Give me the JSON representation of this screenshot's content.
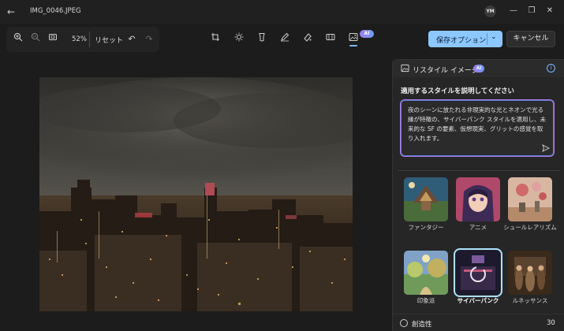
{
  "titlebar": {
    "filename": "IMG_0046.JPEG",
    "avatar_initials": "YM",
    "minimize": "—",
    "restore": "❐",
    "close": "✕"
  },
  "toolbar": {
    "zoom_level": "52%",
    "reset_label": "リセット",
    "ai_badge": "AI",
    "save_label": "保存オプション",
    "cancel_label": "キャンセル"
  },
  "panel": {
    "title": "リスタイル イメージ",
    "ai_badge": "AI",
    "prompt_label": "適用するスタイルを説明してください",
    "prompt_text": "夜のシーンに放たれる非現実的な光とネオンで光る縁が特徴の、サイバーパンク スタイルを適用し、未来的な SF の要素、仮想現実、グリットの感覚を取り入れます。",
    "styles": [
      {
        "label": "ファンタジー"
      },
      {
        "label": "アニメ"
      },
      {
        "label": "シュールレアリズム"
      },
      {
        "label": "印象派"
      },
      {
        "label": "サイバーパンク"
      },
      {
        "label": "ルネッサンス"
      }
    ],
    "selected_style": "サイバーパンク",
    "creativity_label": "創造性",
    "creativity_value": "30"
  },
  "colors": {
    "accent": "#8cc8ff",
    "ai_gradient_start": "#a07cf0",
    "ai_gradient_end": "#6e9ef5",
    "background": "#1c1c1c",
    "panel": "#262626"
  }
}
